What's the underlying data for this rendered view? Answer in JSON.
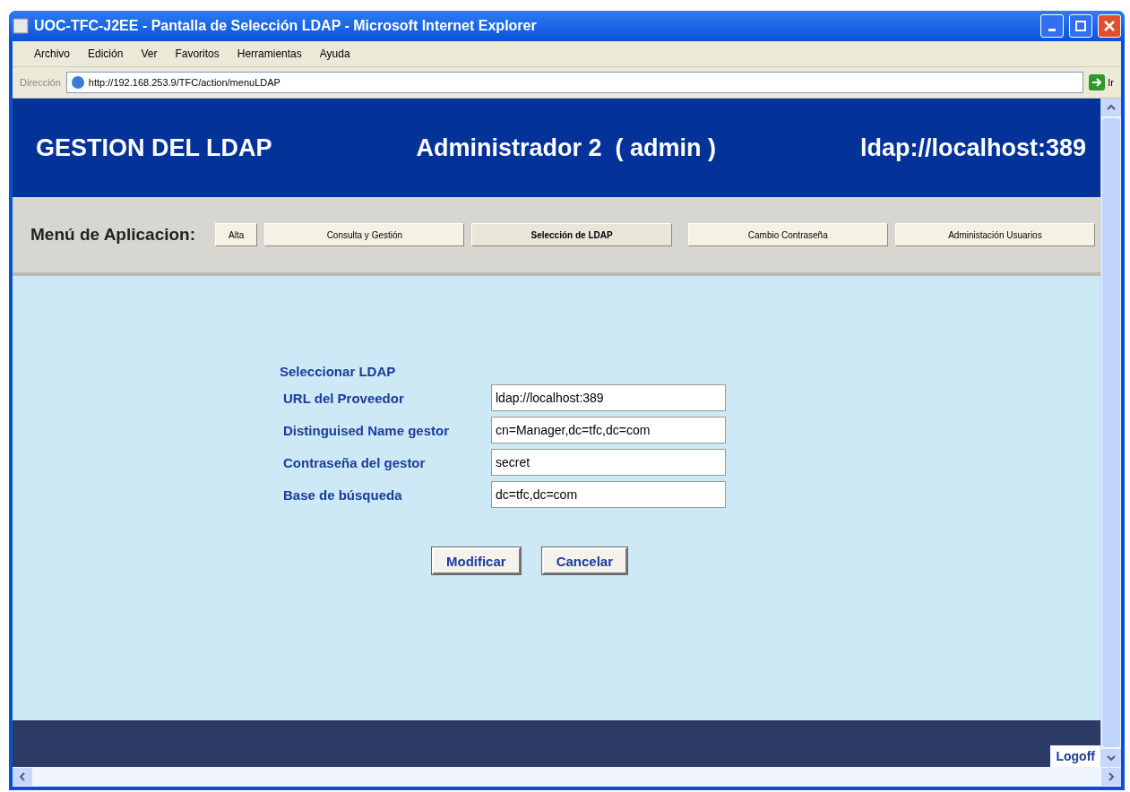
{
  "window": {
    "title": "UOC-TFC-J2EE - Pantalla de Selección LDAP - Microsoft Internet Explorer"
  },
  "menu_bar": [
    "Archivo",
    "Edición",
    "Ver",
    "Favoritos",
    "Herramientas",
    "Ayuda"
  ],
  "address_bar": {
    "label": "Dirección",
    "value": "http://192.168.253.9/TFC/action/menuLDAP",
    "go": "Ir"
  },
  "header": {
    "title": "GESTION DEL LDAP",
    "user": "Administrador 2  ( admin )",
    "server": "ldap://localhost:389"
  },
  "app_menu": {
    "label": "Menú de Aplicacion:",
    "buttons": [
      {
        "label": "Alta",
        "selected": false
      },
      {
        "label": "Consulta y Gestión",
        "selected": false
      },
      {
        "label": "Selección de LDAP",
        "selected": true
      },
      {
        "label": "Cambio Contraseña",
        "selected": false
      },
      {
        "label": "Administación Usuarios",
        "selected": false
      }
    ]
  },
  "form": {
    "title": "Seleccionar LDAP",
    "fields": [
      {
        "label": "URL del Proveedor",
        "value": "ldap://localhost:389"
      },
      {
        "label": "Distinguised Name gestor",
        "value": "cn=Manager,dc=tfc,dc=com"
      },
      {
        "label": "Contraseña del gestor",
        "value": "secret"
      },
      {
        "label": "Base de búsqueda",
        "value": "dc=tfc,dc=com"
      }
    ],
    "buttons": [
      "Modificar",
      "Cancelar"
    ]
  },
  "footer": {
    "logoff": "Logoff"
  }
}
